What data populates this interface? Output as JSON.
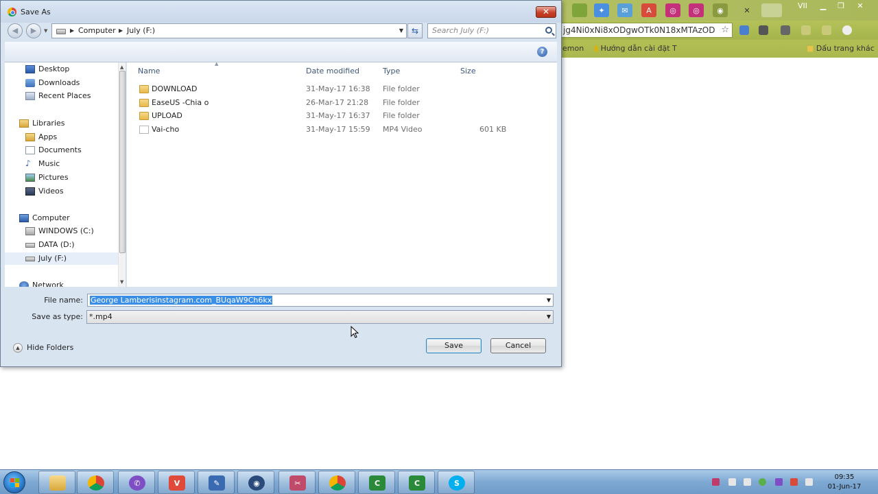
{
  "browser": {
    "url_fragment": "jg4Ni0xNi8xODgwOTk0N18xMTAzOD",
    "user_badge": "VII",
    "bookmarks": [
      "emon",
      "Hướng dẫn cài đặt T",
      "Dấu trang khác"
    ]
  },
  "dialog": {
    "title": "Save As",
    "close_glyph": "✕",
    "breadcrumb": [
      "Computer",
      "July (F:)"
    ],
    "search_placeholder": "Search July (F:)",
    "help_glyph": "?",
    "nav_items": [
      {
        "label": "Desktop"
      },
      {
        "label": "Downloads"
      },
      {
        "label": "Recent Places"
      },
      {
        "label": "Libraries"
      },
      {
        "label": "Apps"
      },
      {
        "label": "Documents"
      },
      {
        "label": "Music"
      },
      {
        "label": "Pictures"
      },
      {
        "label": "Videos"
      },
      {
        "label": "Computer"
      },
      {
        "label": "WINDOWS (C:)"
      },
      {
        "label": "DATA (D:)"
      },
      {
        "label": "July (F:)"
      },
      {
        "label": "Network"
      }
    ],
    "columns": {
      "name": "Name",
      "date": "Date modified",
      "type": "Type",
      "size": "Size"
    },
    "files": [
      {
        "name": "DOWNLOAD",
        "date": "31-May-17 16:38",
        "type": "File folder",
        "size": "",
        "icon": "folder-icon"
      },
      {
        "name": "EaseUS -Chia o",
        "date": "26-Mar-17 21:28",
        "type": "File folder",
        "size": "",
        "icon": "folder-icon"
      },
      {
        "name": "UPLOAD",
        "date": "31-May-17 16:37",
        "type": "File folder",
        "size": "",
        "icon": "folder-icon"
      },
      {
        "name": "Vai-cho",
        "date": "31-May-17 15:59",
        "type": "MP4 Video",
        "size": "601 KB",
        "icon": "video-file-icon"
      }
    ],
    "file_name_label": "File name:",
    "file_name_value": "George Lamberisinstagram.com_BUqaW9Ch6kx",
    "save_as_type_label": "Save as type:",
    "save_as_type_value": "*.mp4",
    "hide_folders_label": "Hide Folders",
    "save_label": "Save",
    "cancel_label": "Cancel"
  },
  "taskbar": {
    "time": "09:35",
    "date": "01-Jun-17"
  },
  "colors": {
    "selection": "#3a8ee6",
    "dialog_bg": "#d9e4f1",
    "taskbar": "#7ea9d3"
  }
}
